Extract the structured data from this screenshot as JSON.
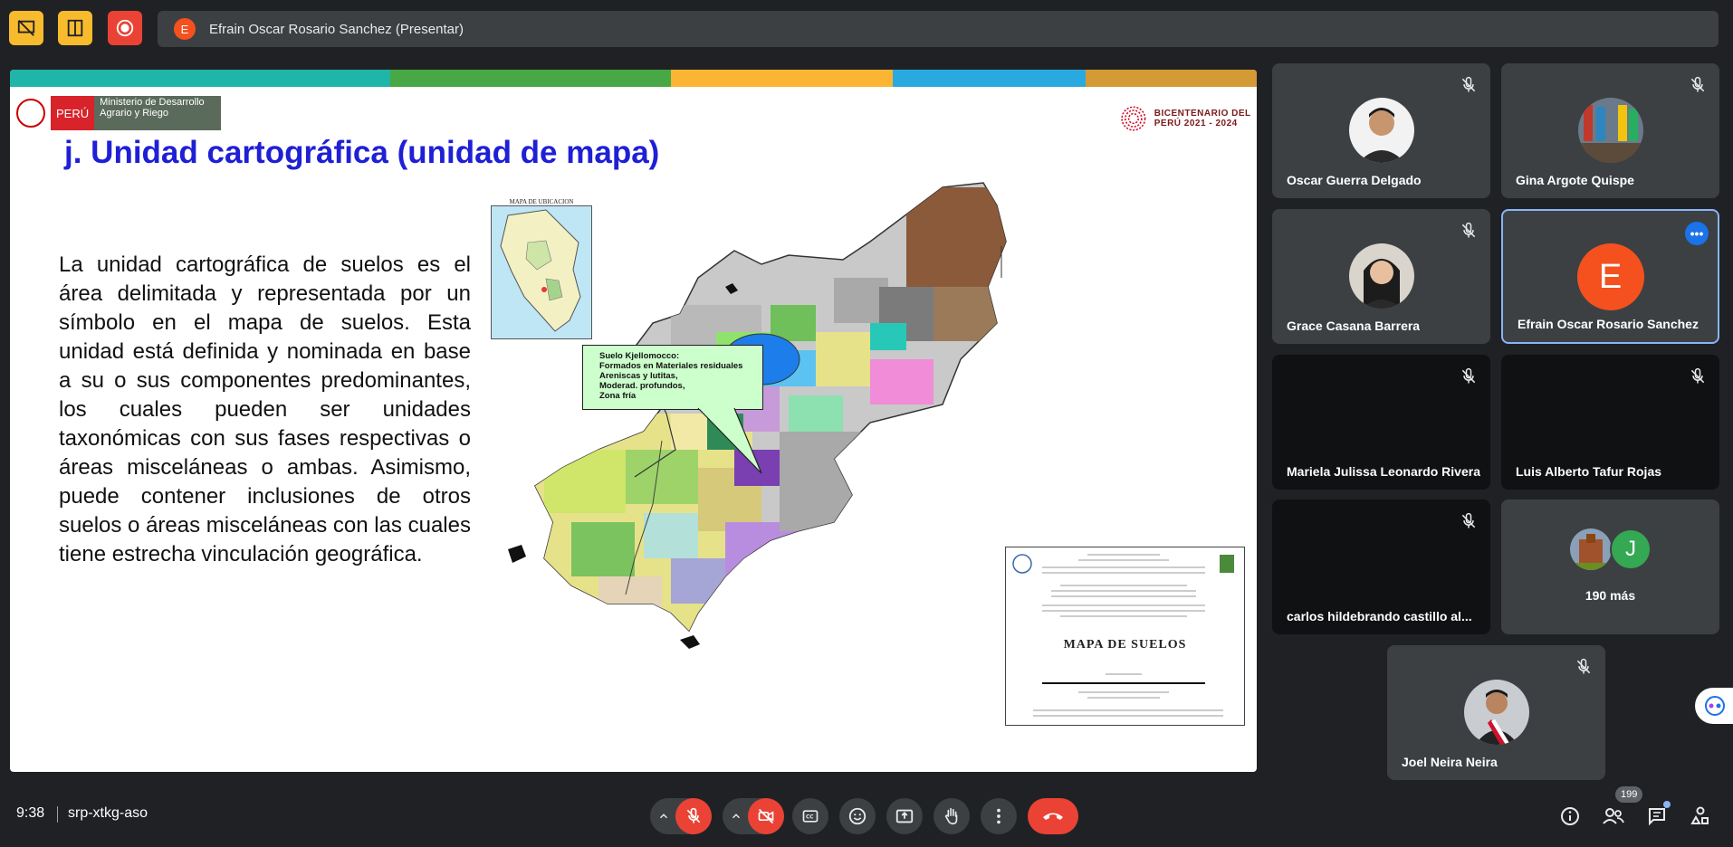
{
  "presenter": {
    "initial": "E",
    "label": "Efrain Oscar Rosario Sanchez (Presentar)"
  },
  "slide": {
    "logo_country": "PERÚ",
    "logo_ministry": "Ministerio de Desarrollo Agrario y Riego",
    "bicentenario": "BICENTENARIO DEL PERÚ 2021 - 2024",
    "title": "j. Unidad cartográfica (unidad de mapa)",
    "body": "La unidad cartográfica de suelos es el área delimitada y representada por un símbolo en el mapa de suelos. Esta unidad está definida y nominada en base a su o sus componentes predominantes, los cuales pueden ser unidades taxonómicas con sus fases respectivas o áreas misceláneas o ambas. Asimismo, puede contener inclusiones de otros suelos o áreas misceláneas con las cuales tiene estrecha vinculación geográfica.",
    "inset_title": "MAPA DE UBICACION",
    "callout": {
      "line1": "Suelo Kjellomocco:",
      "line2": "Formados en Materiales residuales",
      "line3": "Areniscas y lutitas,",
      "line4": "Moderad. profundos,",
      "line5": "Zona fría"
    },
    "legend_title": "MAPA DE SUELOS"
  },
  "participants": [
    {
      "name": "Oscar Guerra Delgado"
    },
    {
      "name": "Gina Argote Quispe"
    },
    {
      "name": "Grace Casana Barrera"
    },
    {
      "name": "Efrain Oscar Rosario Sanchez",
      "initial": "E"
    },
    {
      "name": "Mariela Julissa Leonardo Rivera"
    },
    {
      "name": "Luis Alberto Tafur Rojas"
    },
    {
      "name": "carlos hildebrando castillo al..."
    },
    {
      "more_label": "190 más",
      "initial": "J"
    },
    {
      "name": "Joel Neira Neira"
    }
  ],
  "bottom": {
    "time": "9:38",
    "meeting_code": "srp-xtkg-aso",
    "people_count": "199"
  },
  "icons": {
    "mic": "mic-off-icon",
    "camera": "camera-off-icon",
    "captions": "captions-icon",
    "emoji": "emoji-icon",
    "present": "present-screen-icon",
    "hand": "raise-hand-icon",
    "more": "more-options-icon",
    "end": "end-call-icon",
    "info": "info-icon",
    "people": "people-icon",
    "chat": "chat-icon",
    "activities": "activities-icon"
  },
  "colors": {
    "accent": "#8ab4f8",
    "end_call": "#ea4335",
    "avatar_orange": "#f4511e",
    "title_blue": "#1f1fd6"
  }
}
